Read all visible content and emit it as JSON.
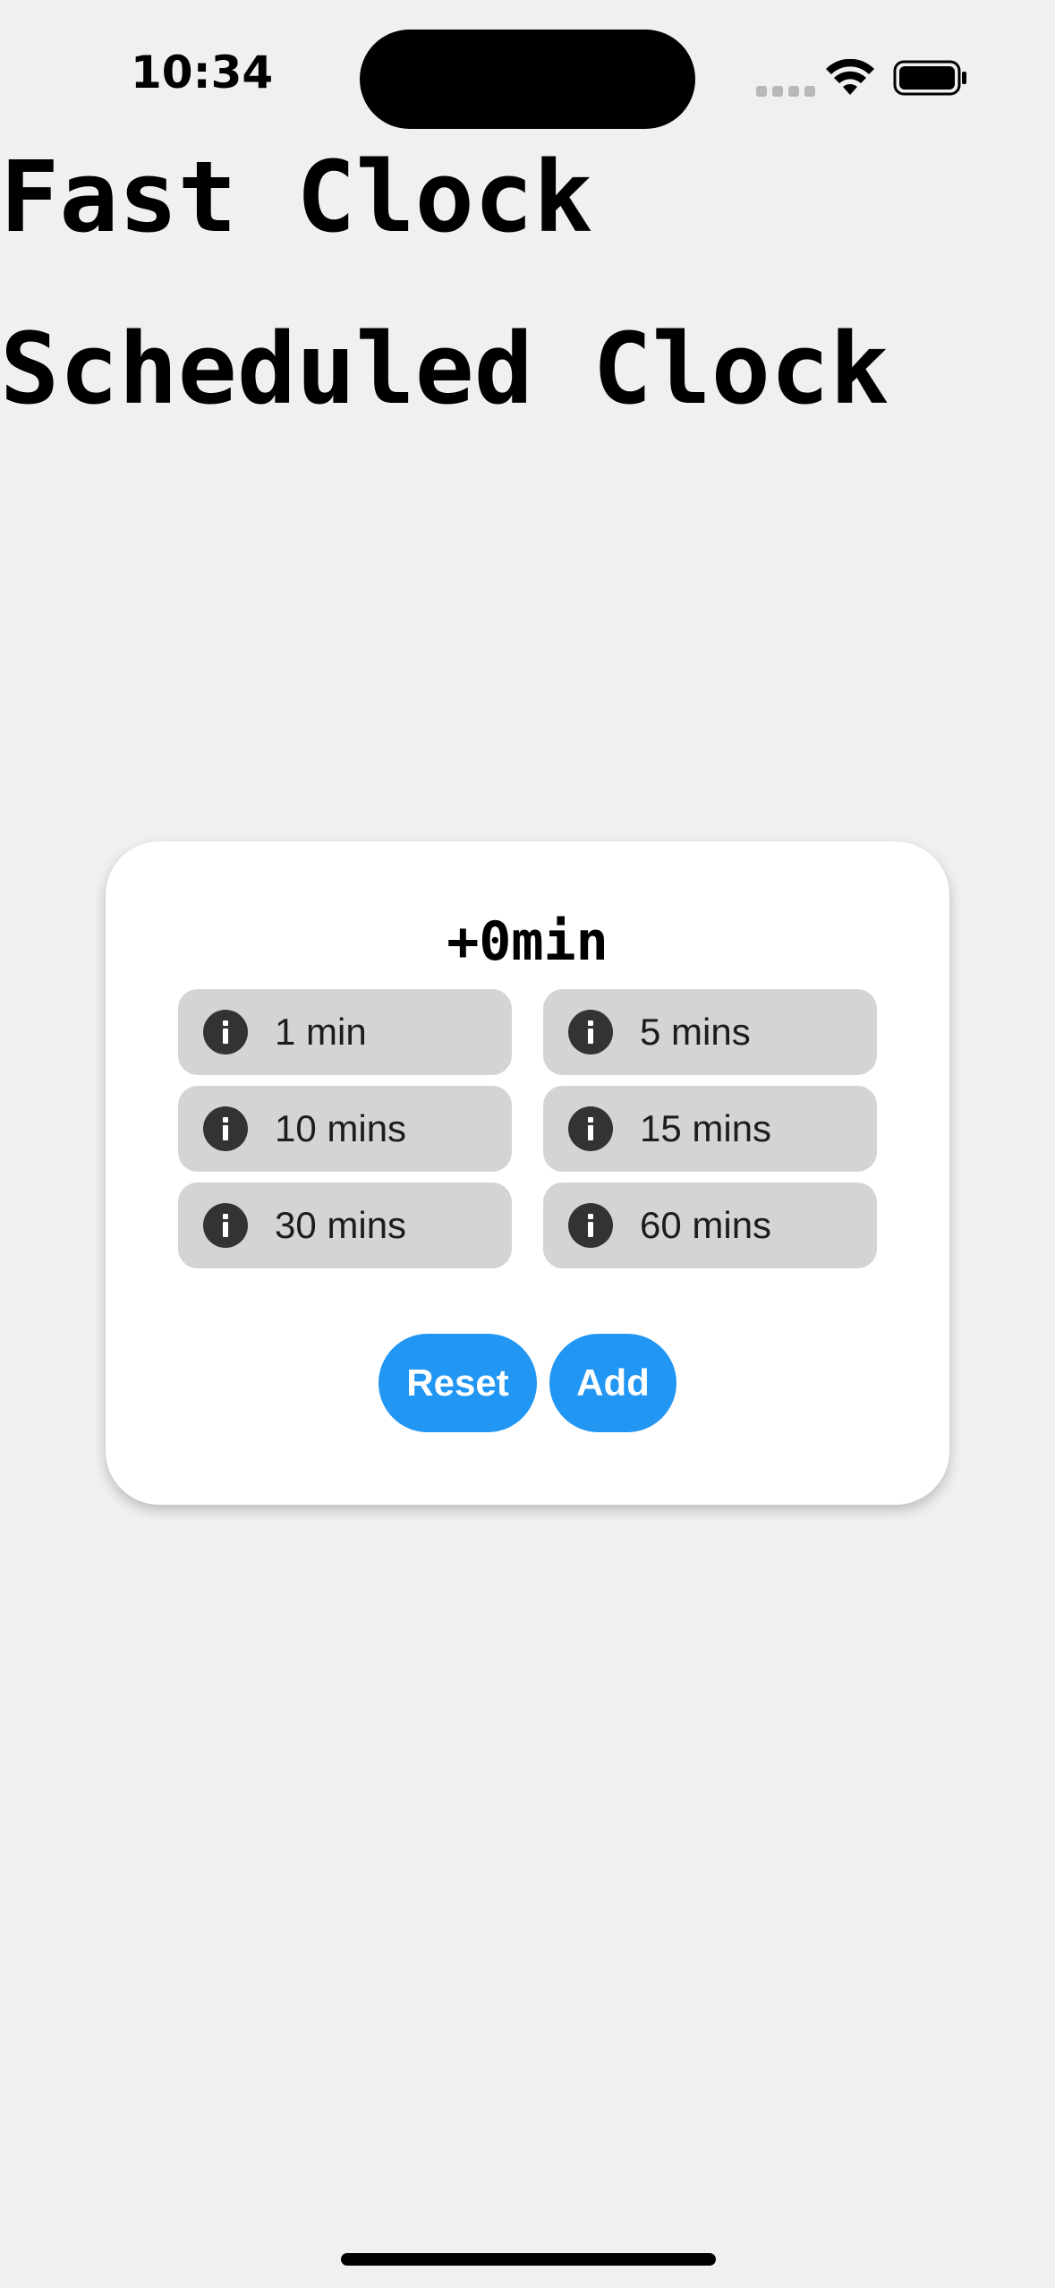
{
  "status_bar": {
    "time": "10:34"
  },
  "titles": {
    "fast_clock": "Fast Clock",
    "scheduled_clock": "Scheduled Clock"
  },
  "dialog": {
    "offset": "+0min",
    "options": [
      {
        "label": "1 min",
        "icon": "info-icon"
      },
      {
        "label": "5 mins",
        "icon": "info-icon"
      },
      {
        "label": "10 mins",
        "icon": "info-icon"
      },
      {
        "label": "15 mins",
        "icon": "info-icon"
      },
      {
        "label": "30 mins",
        "icon": "info-icon"
      },
      {
        "label": "60 mins",
        "icon": "info-icon"
      }
    ],
    "reset_label": "Reset",
    "add_label": "Add"
  },
  "colors": {
    "background": "#f0f0f0",
    "card": "#ffffff",
    "option_bg": "#d4d4d4",
    "accent": "#2196f3"
  }
}
